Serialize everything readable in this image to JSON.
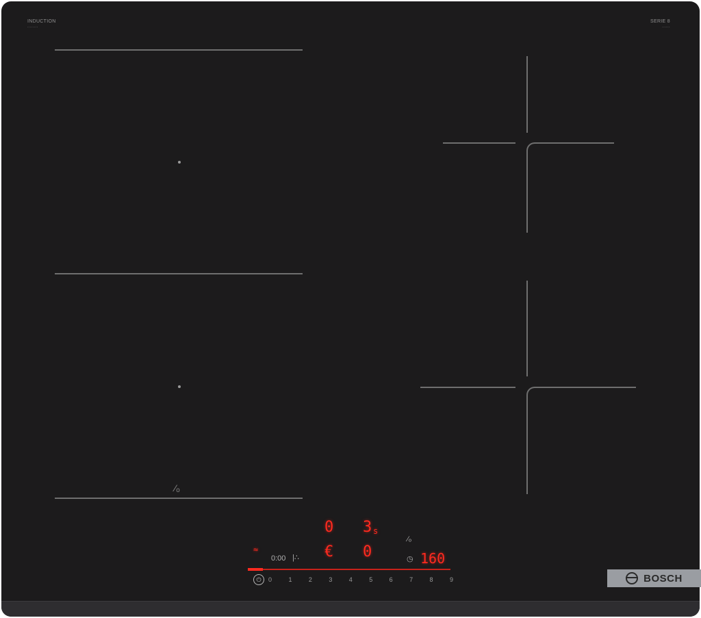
{
  "hob": {
    "top_left_label": "INDUCTION",
    "top_left_sublabel": "········",
    "top_right_label": "SERIE 8",
    "top_right_sublabel": "······"
  },
  "display": {
    "zone_top_left": "0",
    "zone_top_right": "3",
    "zone_top_right_suffix": "s",
    "zone_mid_left": "€",
    "zone_mid_right": "0",
    "left_small": "≈",
    "time_small": "0:00",
    "timer": "160",
    "timer_icon": "◷"
  },
  "power_scale": [
    "0",
    "1",
    "2",
    "3",
    "4",
    "5",
    "6",
    "7",
    "8",
    "9"
  ],
  "brand": {
    "name": "BOSCH"
  }
}
